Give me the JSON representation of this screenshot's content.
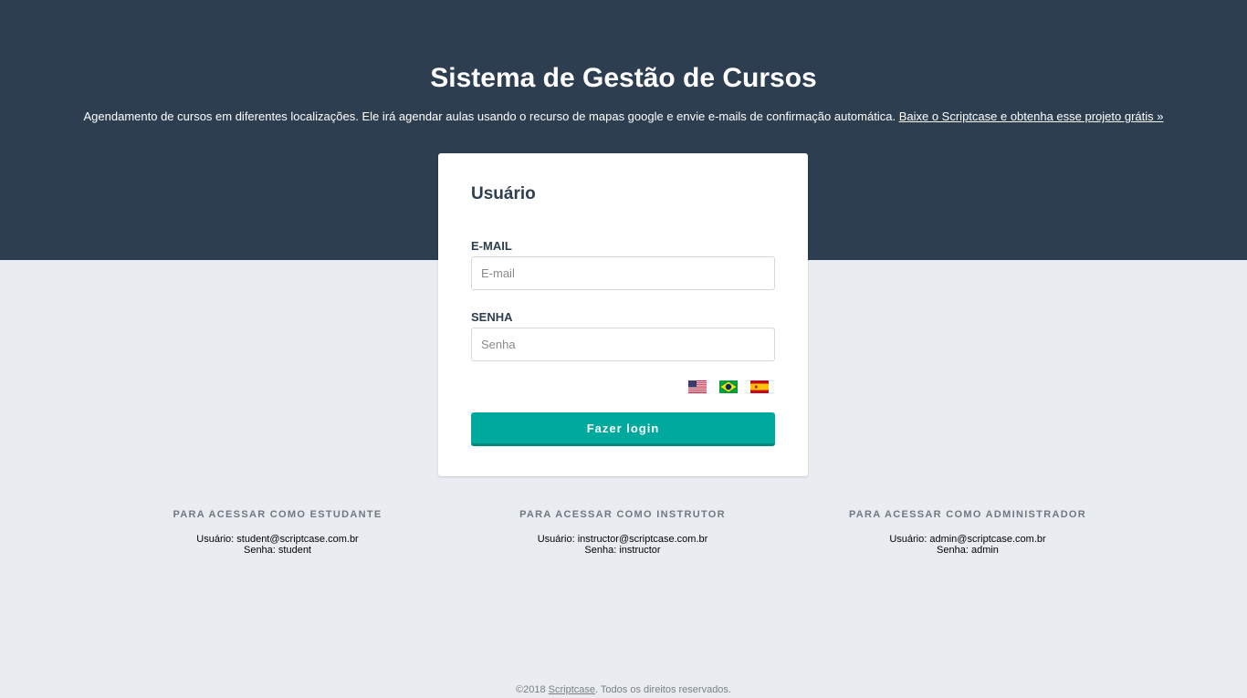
{
  "header": {
    "title": "Sistema de Gestão de Cursos",
    "description": "Agendamento de cursos em diferentes localizações. Ele irá agendar aulas usando o recurso de mapas google e envie e-mails de confirmação automática.",
    "download_link": "Baixe o Scriptcase e obtenha esse projeto grátis »"
  },
  "login": {
    "title": "Usuário",
    "email_label": "E-MAIL",
    "email_placeholder": "E-mail",
    "password_label": "SENHA",
    "password_placeholder": "Senha",
    "languages": [
      {
        "icon": "us-flag-icon"
      },
      {
        "icon": "brazil-flag-icon"
      },
      {
        "icon": "spain-flag-icon"
      }
    ],
    "submit_label": "Fazer login"
  },
  "credentials": [
    {
      "title": "PARA ACESSAR COMO ESTUDANTE",
      "user": "Usuário: student@scriptcase.com.br",
      "password": "Senha: student"
    },
    {
      "title": "PARA ACESSAR COMO INSTRUTOR",
      "user": "Usuário: instructor@scriptcase.com.br",
      "password": "Senha: instructor"
    },
    {
      "title": "PARA ACESSAR COMO ADMINISTRADOR",
      "user": "Usuário: admin@scriptcase.com.br",
      "password": "Senha: admin"
    }
  ],
  "footer": {
    "copyright": "©2018",
    "brand_link": "Scriptcase",
    "rights": ". Todos os direitos reservados."
  },
  "colors": {
    "header_bg": "#2d3e50",
    "page_bg": "#e9edf2",
    "accent": "#00a99d"
  }
}
